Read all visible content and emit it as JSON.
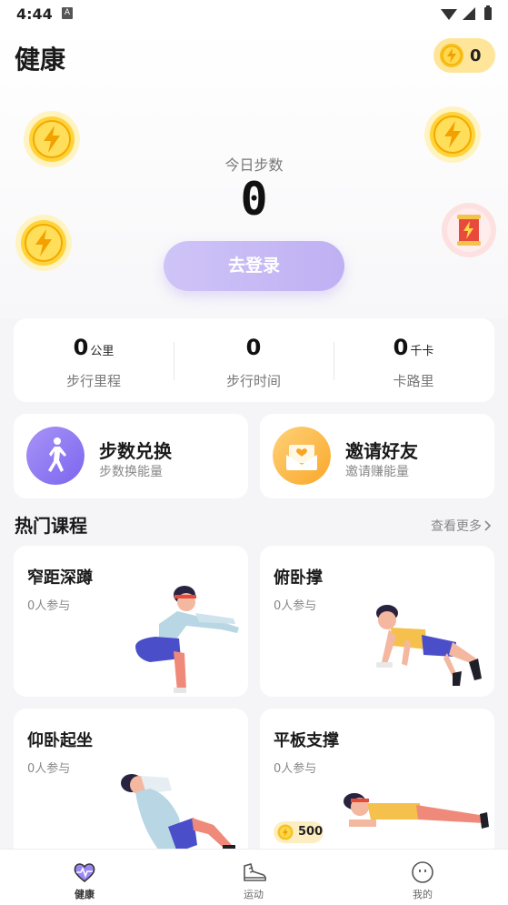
{
  "status_bar": {
    "time": "4:44",
    "notification": "A"
  },
  "header": {
    "title": "健康",
    "energy_count": "0"
  },
  "steps": {
    "label": "今日步数",
    "value": "0",
    "login_button": "去登录"
  },
  "stats": [
    {
      "value": "0",
      "unit": "公里",
      "label": "步行里程"
    },
    {
      "value": "0",
      "unit": "",
      "label": "步行时间"
    },
    {
      "value": "0",
      "unit": "千卡",
      "label": "卡路里"
    }
  ],
  "features": [
    {
      "title": "步数兑换",
      "subtitle": "步数换能量",
      "icon": "walker-icon",
      "color": "#8f7af3"
    },
    {
      "title": "邀请好友",
      "subtitle": "邀请赚能量",
      "icon": "envelope-heart-icon",
      "color": "#fbbf4c"
    }
  ],
  "courses_section": {
    "title": "热门课程",
    "more": "查看更多"
  },
  "courses": [
    {
      "title": "窄距深蹲",
      "participants": "0人参与"
    },
    {
      "title": "俯卧撑",
      "participants": "0人参与"
    },
    {
      "title": "仰卧起坐",
      "participants": "0人参与"
    },
    {
      "title": "平板支撑",
      "participants": "0人参与",
      "reward": "500"
    }
  ],
  "tabs": [
    {
      "label": "健康",
      "icon": "heart-pulse-icon",
      "active": true
    },
    {
      "label": "运动",
      "icon": "sneaker-icon",
      "active": false
    },
    {
      "label": "我的",
      "icon": "smiley-icon",
      "active": false
    }
  ],
  "colors": {
    "accent": "#b9a8f2",
    "coin": "#f5c21b",
    "text": "#1a1a1a"
  }
}
